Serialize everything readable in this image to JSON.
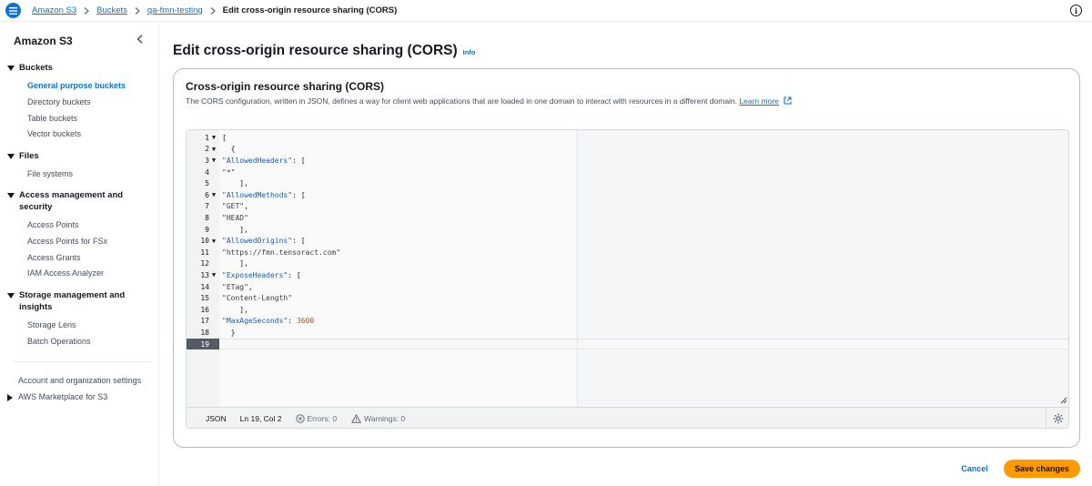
{
  "breadcrumb": {
    "items": [
      "Amazon S3",
      "Buckets",
      "qa-fmn-testing"
    ],
    "current": "Edit cross-origin resource sharing (CORS)"
  },
  "sidebar": {
    "title": "Amazon S3",
    "sections": {
      "buckets": "Buckets",
      "files": "Files",
      "access": "Access management and security",
      "storage": "Storage management and insights"
    },
    "items": {
      "general_purpose": "General purpose buckets",
      "directory": "Directory buckets",
      "table": "Table buckets",
      "vector": "Vector buckets",
      "file_systems": "File systems",
      "access_points": "Access Points",
      "access_points_fsx": "Access Points for FSx",
      "access_grants": "Access Grants",
      "iam_analyzer": "IAM Access Analyzer",
      "storage_lens": "Storage Lens",
      "batch_ops": "Batch Operations",
      "account_settings": "Account and organization settings",
      "marketplace": "AWS Marketplace for S3"
    }
  },
  "page": {
    "title": "Edit cross-origin resource sharing (CORS)",
    "info": "Info"
  },
  "panel": {
    "title": "Cross-origin resource sharing (CORS)",
    "description": "The CORS configuration, written in JSON, defines a way for client web applications that are loaded in one domain to interact with resources in a different domain.",
    "learn_more": "Learn more"
  },
  "editor": {
    "lines": [
      "[",
      "  {",
      "    \"AllowedHeaders\": [",
      "      \"*\"",
      "    ],",
      "    \"AllowedMethods\": [",
      "      \"GET\",",
      "      \"HEAD\"",
      "    ],",
      "    \"AllowedOrigins\": [",
      "      \"https://fmn.tensoract.com\"",
      "    ],",
      "    \"ExposeHeaders\": [",
      "      \"ETag\",",
      "      \"Content-Length\"",
      "    ],",
      "    \"MaxAgeSeconds\": 3600",
      "  }",
      "]"
    ],
    "fold_lines": [
      1,
      2,
      3,
      6,
      10,
      13
    ],
    "active_line": 19,
    "status": {
      "language": "JSON",
      "position": "Ln 19, Col 2",
      "errors": "Errors: 0",
      "warnings": "Warnings: 0"
    }
  },
  "actions": {
    "cancel": "Cancel",
    "save": "Save changes"
  },
  "colors": {
    "accent": "#0972d3",
    "primary_button": "#ff9900"
  }
}
